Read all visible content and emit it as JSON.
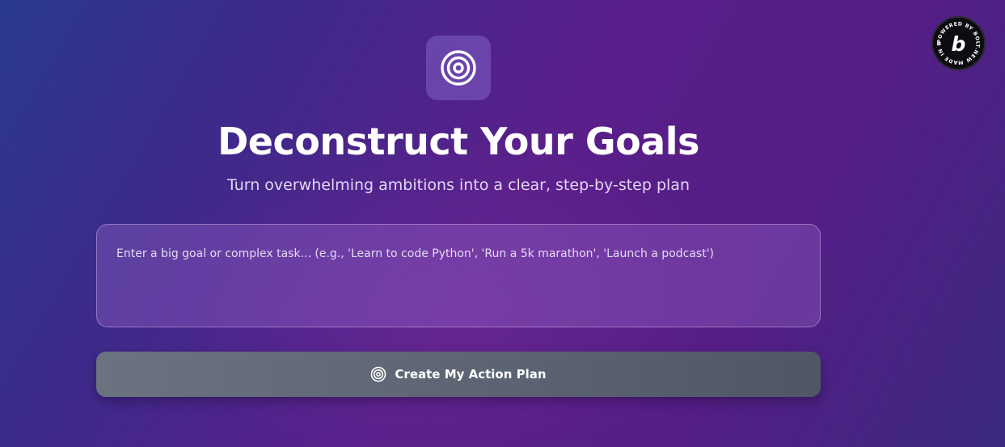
{
  "header": {
    "icon": "target-icon",
    "title": "Deconstruct Your Goals",
    "subtitle": "Turn overwhelming ambitions into a clear, step-by-step plan"
  },
  "goal_input": {
    "value": "",
    "placeholder": "Enter a big goal or complex task... (e.g., 'Learn to code Python', 'Run a 5k marathon', 'Launch a podcast')"
  },
  "action": {
    "icon": "target-icon",
    "label": "Create My Action Plan"
  },
  "badge": {
    "letter": "b",
    "ring_text": "POWERED BY BOLT.NEW MADE IN BOLT.NEW"
  },
  "colors": {
    "background_start": "#2a3a8c",
    "background_mid": "#5a1f8a",
    "button": "#6b7280",
    "text": "#ffffff"
  }
}
